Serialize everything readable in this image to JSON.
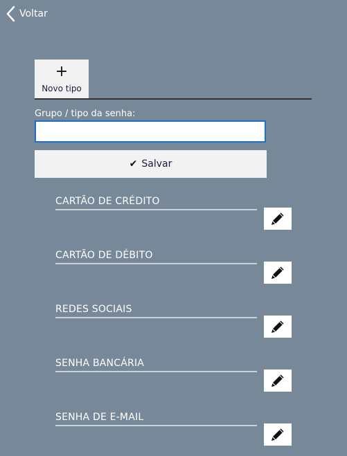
{
  "nav": {
    "back_label": "Voltar",
    "back_icon": "chevron-left-icon"
  },
  "toolbar": {
    "new_type_icon": "plus-icon",
    "new_type_label": "Novo tipo"
  },
  "form": {
    "field_label": "Grupo / tipo da senha:",
    "field_value": "",
    "field_placeholder": "",
    "save_icon": "check-icon",
    "save_label": "Salvar"
  },
  "categories": [
    {
      "title": "CARTÃO DE CRÉDITO",
      "edit_icon": "pencil-icon"
    },
    {
      "title": "CARTÃO DE DÉBITO",
      "edit_icon": "pencil-icon"
    },
    {
      "title": "REDES SOCIAIS",
      "edit_icon": "pencil-icon"
    },
    {
      "title": "SENHA BANCÁRIA",
      "edit_icon": "pencil-icon"
    },
    {
      "title": "SENHA DE E-MAIL",
      "edit_icon": "pencil-icon"
    }
  ],
  "colors": {
    "background": "#778899",
    "accent_border": "#1f6fc4",
    "button_background": "#f2f2f2"
  }
}
